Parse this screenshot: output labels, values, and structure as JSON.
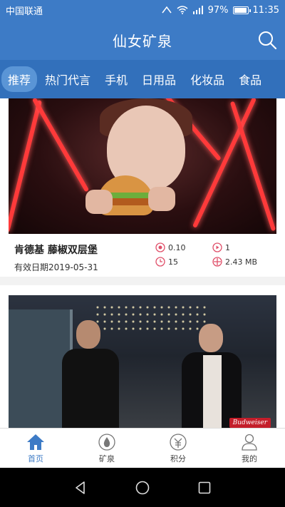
{
  "status_bar": {
    "carrier": "中国联通",
    "battery": "97%",
    "time": "11:35",
    "battery_level": 0.97
  },
  "header": {
    "title": "仙女矿泉",
    "search_icon": "search-icon"
  },
  "tabs": [
    {
      "label": "推荐",
      "active": true
    },
    {
      "label": "热门代言",
      "active": false
    },
    {
      "label": "手机",
      "active": false
    },
    {
      "label": "日用品",
      "active": false
    },
    {
      "label": "化妆品",
      "active": false
    },
    {
      "label": "食品",
      "active": false
    }
  ],
  "feed": [
    {
      "title": "肯德基 藤椒双层堡",
      "date": "有效日期2019-05-31",
      "reward": "0.10",
      "plays": "1",
      "duration": "15",
      "size": "2.43 MB"
    },
    {
      "brand_badge": "Budweiser"
    }
  ],
  "bottom_nav": [
    {
      "label": "首页",
      "icon": "home-icon",
      "active": true
    },
    {
      "label": "矿泉",
      "icon": "water-drop-icon",
      "active": false
    },
    {
      "label": "积分",
      "icon": "points-icon",
      "active": false
    },
    {
      "label": "我的",
      "icon": "user-icon",
      "active": false
    }
  ],
  "colors": {
    "primary": "#3d7bc6",
    "tabs_bg": "#3270bb",
    "active_tab": "#5a95d6"
  }
}
